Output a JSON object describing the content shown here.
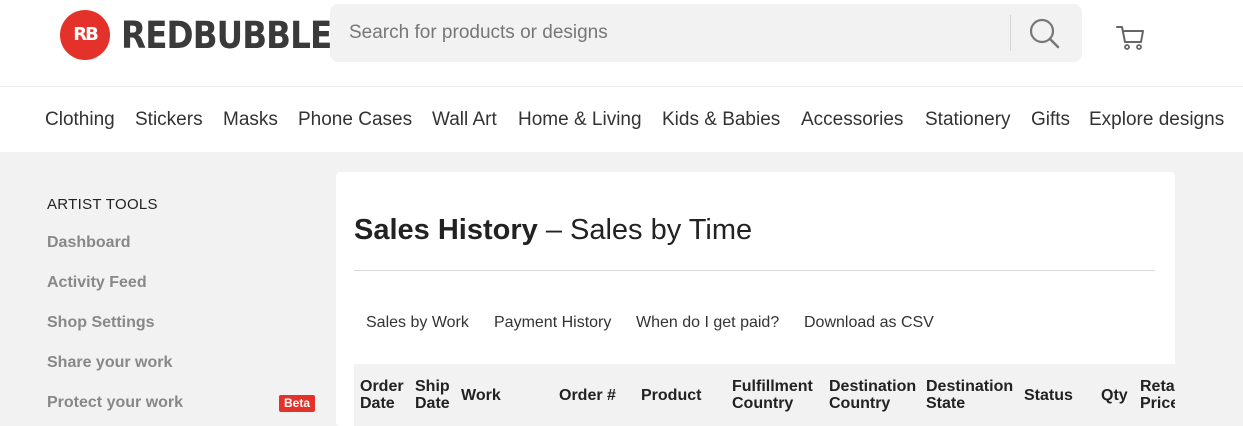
{
  "header": {
    "logo_mark": "RB",
    "logo_text": "REDBUBBLE",
    "search_placeholder": "Search for products or designs",
    "search_icon": "search-icon",
    "cart_icon": "cart-icon",
    "brand_color": "#e4322b"
  },
  "nav": {
    "items": [
      "Clothing",
      "Stickers",
      "Masks",
      "Phone Cases",
      "Wall Art",
      "Home & Living",
      "Kids & Babies",
      "Accessories",
      "Stationery",
      "Gifts",
      "Explore designs"
    ]
  },
  "sidebar": {
    "title": "ARTIST TOOLS",
    "items": [
      "Dashboard",
      "Activity Feed",
      "Shop Settings",
      "Share your work",
      "Protect your work"
    ],
    "badge": "Beta"
  },
  "main": {
    "title_bold": "Sales History",
    "title_rest": " – Sales by Time",
    "tabs": [
      "Sales by Work",
      "Payment History",
      "When do I get paid?",
      "Download as CSV"
    ],
    "table_headers": [
      [
        "Order",
        "Date"
      ],
      [
        "Ship",
        "Date"
      ],
      [
        "Work"
      ],
      [
        "Order #"
      ],
      [
        "Product"
      ],
      [
        "Fulfillment",
        "Country"
      ],
      [
        "Destination",
        "Country"
      ],
      [
        "Destination",
        "State"
      ],
      [
        "Status"
      ],
      [
        "Qty"
      ],
      [
        "Retail",
        "Price"
      ]
    ]
  }
}
